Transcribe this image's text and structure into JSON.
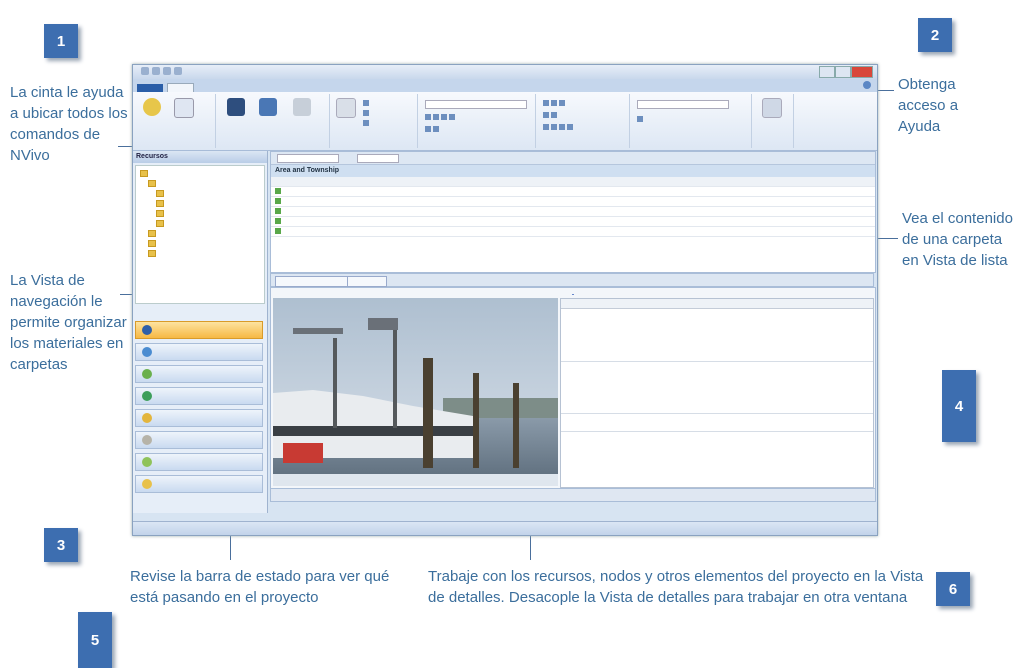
{
  "callouts": {
    "c1": {
      "number": "1",
      "text": "La cinta le ayuda a ubicar todos los comandos de NVivo"
    },
    "c2": {
      "number": "2",
      "text": "Obtenga acceso a Ayuda"
    },
    "c3": {
      "number": "3",
      "text": "La Vista de navegación le permite organizar los materiales en carpetas"
    },
    "c4": {
      "number": "4",
      "text": "Vea el contenido de una carpeta en Vista de lista"
    },
    "c5": {
      "number": "5",
      "text": "Revise la barra de estado para ver qué está pasando en el proyecto"
    },
    "c6": {
      "number": "6",
      "text": "Trabaje con los recursos, nodos y otros elementos del proyecto en la Vista de detalles. Desacople la Vista de detalles para trabajar en otra ventana"
    }
  },
  "app": {
    "nav_header": "Recursos",
    "list_title": "Area and Township",
    "colors": {
      "file_tab": "#2a5ea8",
      "nav_active": "#f6b845",
      "close": "#d8473a"
    }
  },
  "icons": [
    "help-icon",
    "close-icon",
    "folder-icon",
    "video-icon"
  ]
}
